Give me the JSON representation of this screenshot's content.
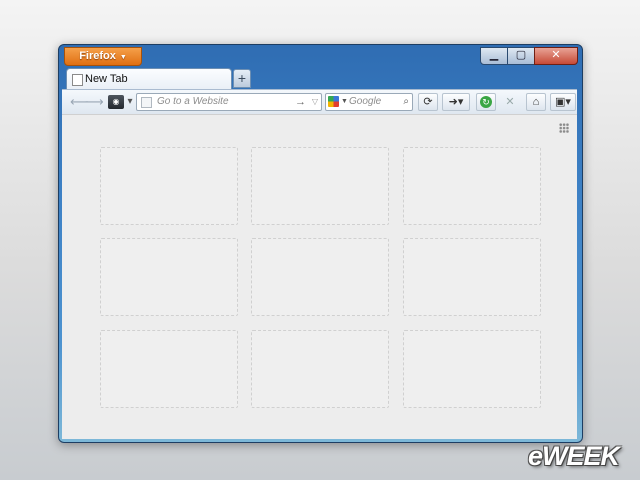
{
  "window": {
    "menu_button": "Firefox",
    "controls": {
      "minimize": "▁",
      "maximize": "▢",
      "close": "✕"
    }
  },
  "tabs": [
    {
      "label": "New Tab"
    }
  ],
  "toolbar": {
    "url_placeholder": "Go to a Website",
    "search_placeholder": "Google",
    "search_engine": "Google"
  },
  "new_tab_page": {
    "tile_count": 9
  },
  "logo": "eWEEK"
}
